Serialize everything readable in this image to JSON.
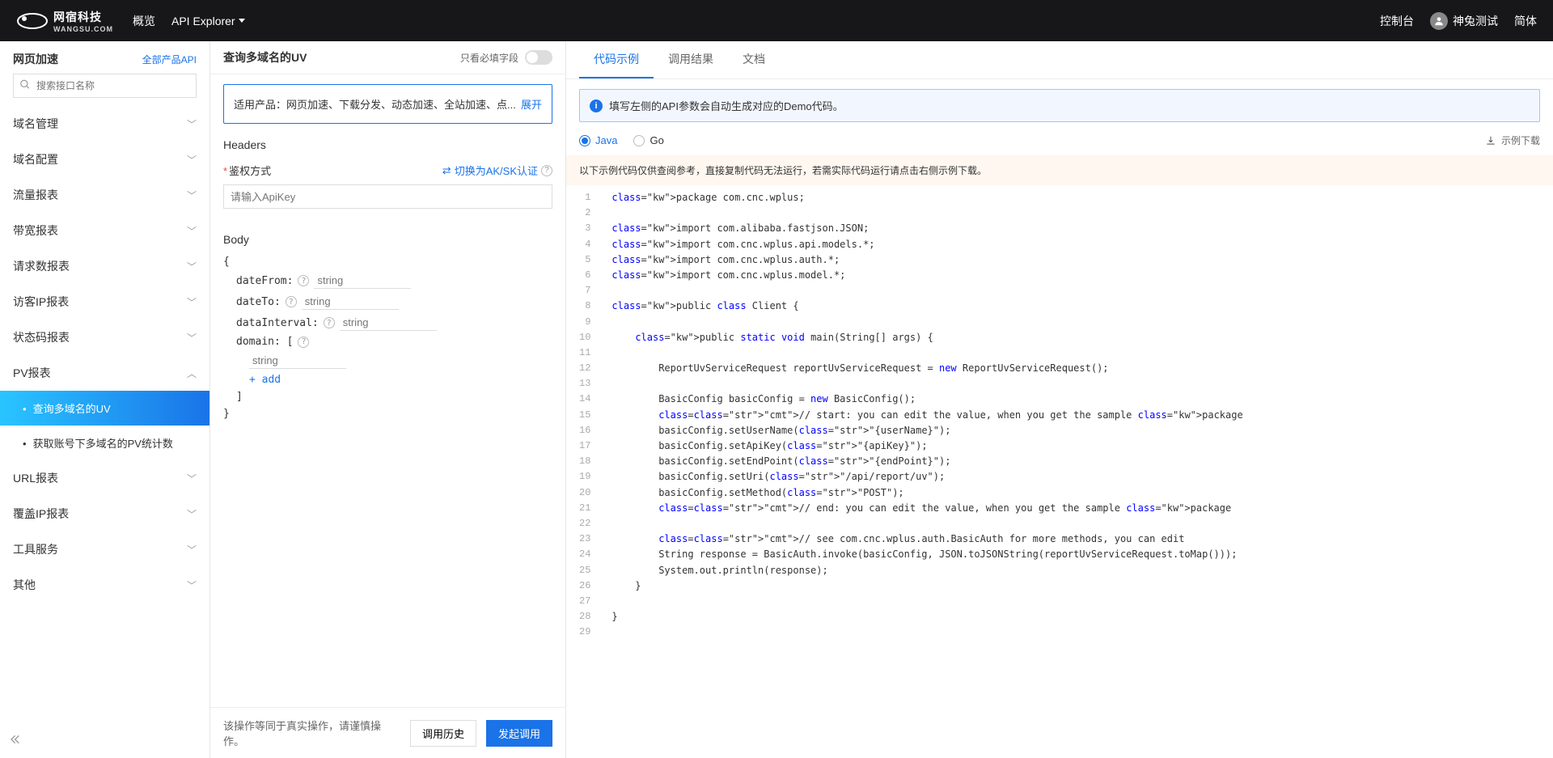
{
  "topbar": {
    "logo_text": "网宿科技",
    "logo_sub": "WANGSU.COM",
    "nav_overview": "概览",
    "nav_api": "API Explorer",
    "console": "控制台",
    "user": "神兔测试",
    "lang": "简体"
  },
  "sidebar": {
    "title": "网页加速",
    "all_api": "全部产品API",
    "search_placeholder": "搜索接口名称",
    "groups": [
      {
        "label": "域名管理"
      },
      {
        "label": "域名配置"
      },
      {
        "label": "流量报表"
      },
      {
        "label": "带宽报表"
      },
      {
        "label": "请求数报表"
      },
      {
        "label": "访客IP报表"
      },
      {
        "label": "状态码报表"
      }
    ],
    "pv_label": "PV报表",
    "pv_sub": [
      {
        "label": "查询多域名的UV",
        "active": true
      },
      {
        "label": "获取账号下多域名的PV统计数",
        "active": false
      }
    ],
    "groups2": [
      {
        "label": "URL报表"
      },
      {
        "label": "覆盖IP报表"
      },
      {
        "label": "工具服务"
      },
      {
        "label": "其他"
      }
    ]
  },
  "middle": {
    "title": "查询多域名的UV",
    "only_required": "只看必填字段",
    "product_text": "适用产品：网页加速、下载分发、动态加速、全站加速、点...",
    "expand": "展开",
    "headers_title": "Headers",
    "auth_label": "鉴权方式",
    "auth_switch": "切换为AK/SK认证",
    "apikey_placeholder": "请输入ApiKey",
    "body_title": "Body",
    "fields": {
      "dateFrom": {
        "key": "dateFrom:",
        "type": "string"
      },
      "dateTo": {
        "key": "dateTo:",
        "type": "string"
      },
      "dataInterval": {
        "key": "dataInterval:",
        "type": "string"
      },
      "domain": {
        "key": "domain:  [",
        "type": "string"
      }
    },
    "add": "+ add",
    "footer_note": "该操作等同于真实操作，请谨慎操作。",
    "btn_history": "调用历史",
    "btn_call": "发起调用"
  },
  "right": {
    "tabs": {
      "code": "代码示例",
      "result": "调用结果",
      "doc": "文档"
    },
    "info": "填写左侧的API参数会自动生成对应的Demo代码。",
    "lang_java": "Java",
    "lang_go": "Go",
    "download": "示例下载",
    "warn": "以下示例代码仅供查阅参考，直接复制代码无法运行，若需实际代码运行请点击右侧示例下载。",
    "code_lines": [
      "package com.cnc.wplus;",
      "",
      "import com.alibaba.fastjson.JSON;",
      "import com.cnc.wplus.api.models.*;",
      "import com.cnc.wplus.auth.*;",
      "import com.cnc.wplus.model.*;",
      "",
      "public class Client {",
      "",
      "    public static void main(String[] args) {",
      "",
      "        ReportUvServiceRequest reportUvServiceRequest = new ReportUvServiceRequest();",
      "",
      "        BasicConfig basicConfig = new BasicConfig();",
      "        // start: you can edit the value, when you get the sample package",
      "        basicConfig.setUserName(\"{userName}\");",
      "        basicConfig.setApiKey(\"{apiKey}\");",
      "        basicConfig.setEndPoint(\"{endPoint}\");",
      "        basicConfig.setUri(\"/api/report/uv\");",
      "        basicConfig.setMethod(\"POST\");",
      "        // end: you can edit the value, when you get the sample package",
      "",
      "        // see com.cnc.wplus.auth.BasicAuth for more methods, you can edit",
      "        String response = BasicAuth.invoke(basicConfig, JSON.toJSONString(reportUvServiceRequest.toMap()));",
      "        System.out.println(response);",
      "    }",
      "",
      "}",
      ""
    ]
  }
}
